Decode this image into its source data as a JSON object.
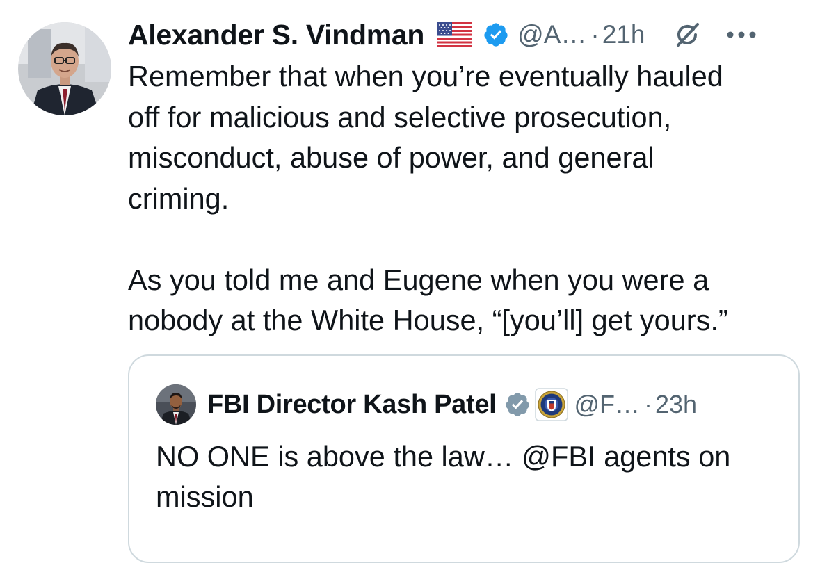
{
  "tweet": {
    "author_name": "Alexander S. Vindman",
    "handle": "@A…",
    "separator": "·",
    "time": "21h",
    "text": "Remember that when you’re eventually hauled\noff for malicious and selective prosecution,\nmisconduct, abuse of power, and general\ncriming.\n\nAs you told me and Eugene when you were a\nnobody at the White House, “[you’ll] get yours.”",
    "icons": {
      "flag": "us-flag-icon",
      "badge": "verified-blue-check-icon",
      "grok": "grok-icon",
      "more": "more-options-icon"
    }
  },
  "quote": {
    "author_name": "FBI Director Kash Patel",
    "handle": "@F…",
    "separator": "·",
    "time": "23h",
    "text": "NO ONE is above the law… @FBI agents on\nmission",
    "icons": {
      "badge": "verified-gray-check-icon",
      "affiliate": "fbi-seal-icon"
    }
  },
  "colors": {
    "text": "#0f1419",
    "secondary_text": "#536471",
    "verified_blue": "#1d9bf0",
    "verified_gray": "#829aab",
    "border": "#cfd9de"
  }
}
